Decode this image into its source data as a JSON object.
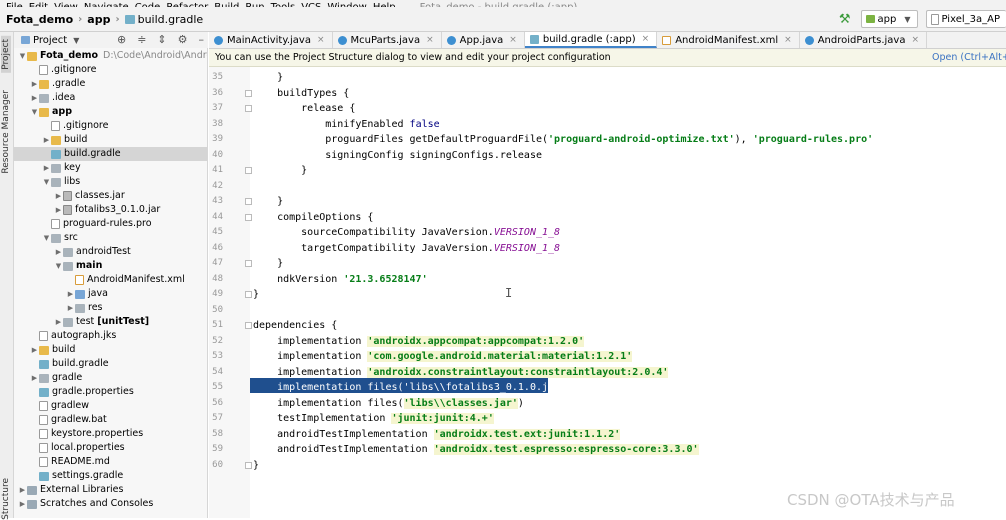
{
  "menu": {
    "items": [
      "File",
      "Edit",
      "View",
      "Navigate",
      "Code",
      "Refactor",
      "Build",
      "Run",
      "Tools",
      "VCS",
      "Window",
      "Help"
    ],
    "window_title": "Fota_demo - build.gradle (:app)"
  },
  "navbar": {
    "project": "Fota_demo",
    "module": "app",
    "file": "build.gradle",
    "run_config": "app",
    "device": "Pixel_3a_AP"
  },
  "side_stripe": {
    "top_tools": [
      "Project",
      "Resource Manager"
    ],
    "bottom_tools": [
      "Structure"
    ]
  },
  "project_panel": {
    "title": "Project",
    "tree": [
      {
        "label": "Fota_demo",
        "hint": "D:\\Code\\Android\\AndroidSt",
        "depth": 0,
        "expanded": true,
        "icon": "module-folder",
        "bold": true
      },
      {
        "label": ".gitignore",
        "depth": 1,
        "icon": "file"
      },
      {
        "label": ".gradle",
        "depth": 1,
        "expanded": false,
        "icon": "folder"
      },
      {
        "label": ".idea",
        "depth": 1,
        "expanded": false,
        "icon": "folder-grey"
      },
      {
        "label": "app",
        "depth": 1,
        "expanded": true,
        "icon": "module-folder",
        "bold": true
      },
      {
        "label": ".gitignore",
        "depth": 2,
        "icon": "file"
      },
      {
        "label": "build",
        "depth": 2,
        "expanded": false,
        "icon": "folder"
      },
      {
        "label": "build.gradle",
        "depth": 2,
        "icon": "gradle",
        "selected": true
      },
      {
        "label": "key",
        "depth": 2,
        "expanded": false,
        "icon": "folder-grey"
      },
      {
        "label": "libs",
        "depth": 2,
        "expanded": true,
        "icon": "folder-grey"
      },
      {
        "label": "classes.jar",
        "depth": 3,
        "expanded": false,
        "icon": "jar"
      },
      {
        "label": "fotalibs3_0.1.0.jar",
        "depth": 3,
        "expanded": false,
        "icon": "jar"
      },
      {
        "label": "proguard-rules.pro",
        "depth": 2,
        "icon": "file"
      },
      {
        "label": "src",
        "depth": 2,
        "expanded": true,
        "icon": "folder-grey"
      },
      {
        "label": "androidTest",
        "depth": 3,
        "expanded": false,
        "icon": "folder-grey"
      },
      {
        "label": "main",
        "depth": 3,
        "expanded": true,
        "icon": "folder-grey",
        "bold": true
      },
      {
        "label": "AndroidManifest.xml",
        "depth": 4,
        "icon": "xml"
      },
      {
        "label": "java",
        "depth": 4,
        "expanded": false,
        "icon": "folder-blue"
      },
      {
        "label": "res",
        "depth": 4,
        "expanded": false,
        "icon": "folder-grey"
      },
      {
        "label": "test [unitTest]",
        "depth": 3,
        "expanded": false,
        "icon": "folder-grey",
        "bold_suffix": "[unitTest]"
      },
      {
        "label": "autograph.jks",
        "depth": 1,
        "icon": "file"
      },
      {
        "label": "build",
        "depth": 1,
        "expanded": false,
        "icon": "folder"
      },
      {
        "label": "build.gradle",
        "depth": 1,
        "icon": "gradle"
      },
      {
        "label": "gradle",
        "depth": 1,
        "expanded": false,
        "icon": "folder-grey"
      },
      {
        "label": "gradle.properties",
        "depth": 1,
        "icon": "gradle"
      },
      {
        "label": "gradlew",
        "depth": 1,
        "icon": "file"
      },
      {
        "label": "gradlew.bat",
        "depth": 1,
        "icon": "file"
      },
      {
        "label": "keystore.properties",
        "depth": 1,
        "icon": "file"
      },
      {
        "label": "local.properties",
        "depth": 1,
        "icon": "file"
      },
      {
        "label": "README.md",
        "depth": 1,
        "icon": "file"
      },
      {
        "label": "settings.gradle",
        "depth": 1,
        "icon": "gradle"
      },
      {
        "label": "External Libraries",
        "depth": 0,
        "expanded": false,
        "icon": "libs"
      },
      {
        "label": "Scratches and Consoles",
        "depth": 0,
        "expanded": false,
        "icon": "scratch"
      }
    ]
  },
  "tabs": [
    {
      "label": "MainActivity.java",
      "icon": "java",
      "active": false
    },
    {
      "label": "McuParts.java",
      "icon": "java",
      "active": false
    },
    {
      "label": "App.java",
      "icon": "java",
      "active": false
    },
    {
      "label": "build.gradle (:app)",
      "icon": "gradle",
      "active": true
    },
    {
      "label": "AndroidManifest.xml",
      "icon": "xml",
      "active": false
    },
    {
      "label": "AndroidParts.java",
      "icon": "java",
      "active": false
    }
  ],
  "banner": {
    "message": "You can use the Project Structure dialog to view and edit your project configuration",
    "link": "Open (Ctrl+Alt+Sh"
  },
  "editor": {
    "selected_line": 55,
    "lines": [
      {
        "n": 35,
        "parts": [
          {
            "t": "    }",
            "c": "plain"
          }
        ]
      },
      {
        "n": 36,
        "parts": [
          {
            "t": "    buildTypes {",
            "c": "plain"
          }
        ]
      },
      {
        "n": 37,
        "parts": [
          {
            "t": "        release {",
            "c": "plain"
          }
        ]
      },
      {
        "n": 38,
        "parts": [
          {
            "t": "            minifyEnabled ",
            "c": "plain"
          },
          {
            "t": "false",
            "c": "kw"
          }
        ]
      },
      {
        "n": 39,
        "parts": [
          {
            "t": "            proguardFiles getDefaultProguardFile(",
            "c": "plain"
          },
          {
            "t": "'proguard-android-optimize.txt'",
            "c": "str"
          },
          {
            "t": "), ",
            "c": "plain"
          },
          {
            "t": "'proguard-rules.pro'",
            "c": "str"
          }
        ]
      },
      {
        "n": 40,
        "parts": [
          {
            "t": "            signingConfig signingConfigs.release",
            "c": "plain"
          }
        ]
      },
      {
        "n": 41,
        "parts": [
          {
            "t": "        }",
            "c": "plain"
          }
        ]
      },
      {
        "n": 42,
        "parts": [
          {
            "t": "",
            "c": "plain"
          }
        ]
      },
      {
        "n": 43,
        "parts": [
          {
            "t": "    }",
            "c": "plain"
          }
        ]
      },
      {
        "n": 44,
        "parts": [
          {
            "t": "    compileOptions {",
            "c": "plain"
          }
        ]
      },
      {
        "n": 45,
        "parts": [
          {
            "t": "        sourceCompatibility JavaVersion.",
            "c": "plain"
          },
          {
            "t": "VERSION_1_8",
            "c": "const"
          }
        ]
      },
      {
        "n": 46,
        "parts": [
          {
            "t": "        targetCompatibility JavaVersion.",
            "c": "plain"
          },
          {
            "t": "VERSION_1_8",
            "c": "const"
          }
        ]
      },
      {
        "n": 47,
        "parts": [
          {
            "t": "    }",
            "c": "plain"
          }
        ]
      },
      {
        "n": 48,
        "parts": [
          {
            "t": "    ndkVersion ",
            "c": "plain"
          },
          {
            "t": "'21.3.6528147'",
            "c": "str"
          }
        ]
      },
      {
        "n": 49,
        "parts": [
          {
            "t": "}",
            "c": "plain"
          }
        ]
      },
      {
        "n": 50,
        "parts": [
          {
            "t": "",
            "c": "plain"
          }
        ]
      },
      {
        "n": 51,
        "parts": [
          {
            "t": "dependencies {",
            "c": "plain"
          }
        ]
      },
      {
        "n": 52,
        "parts": [
          {
            "t": "    implementation ",
            "c": "plain"
          },
          {
            "t": "'androidx.appcompat:appcompat:1.2.0'",
            "c": "str-hl"
          }
        ]
      },
      {
        "n": 53,
        "parts": [
          {
            "t": "    implementation ",
            "c": "plain"
          },
          {
            "t": "'com.google.android.material:material:1.2.1'",
            "c": "str-hl"
          }
        ]
      },
      {
        "n": 54,
        "parts": [
          {
            "t": "    implementation ",
            "c": "plain"
          },
          {
            "t": "'androidx.constraintlayout:constraintlayout:2.0.4'",
            "c": "str-hl"
          }
        ]
      },
      {
        "n": 55,
        "parts": [
          {
            "t": "    implementation files('libs\\\\fotalibs3_0.1.0.jar')",
            "c": "selected"
          }
        ]
      },
      {
        "n": 56,
        "parts": [
          {
            "t": "    implementation ",
            "c": "plain"
          },
          {
            "t": "files(",
            "c": "plain"
          },
          {
            "t": "'libs\\\\classes.jar'",
            "c": "str-hl"
          },
          {
            "t": ")",
            "c": "plain"
          }
        ]
      },
      {
        "n": 57,
        "parts": [
          {
            "t": "    testImplementation ",
            "c": "plain"
          },
          {
            "t": "'junit:junit:4.+'",
            "c": "str-hl"
          }
        ]
      },
      {
        "n": 58,
        "parts": [
          {
            "t": "    androidTestImplementation ",
            "c": "plain"
          },
          {
            "t": "'androidx.test.ext:junit:1.1.2'",
            "c": "str-hl"
          }
        ]
      },
      {
        "n": 59,
        "parts": [
          {
            "t": "    androidTestImplementation ",
            "c": "plain"
          },
          {
            "t": "'androidx.test.espresso:espresso-core:3.3.0'",
            "c": "str-hl"
          }
        ]
      },
      {
        "n": 60,
        "parts": [
          {
            "t": "}",
            "c": "plain"
          }
        ]
      }
    ]
  },
  "watermark": "CSDN @OTA技术与产品",
  "colors": {
    "selection": "#1f4f8e",
    "string": "#067d17",
    "keyword": "#000080",
    "constant": "#871094",
    "tab_underline": "#4083c9"
  }
}
